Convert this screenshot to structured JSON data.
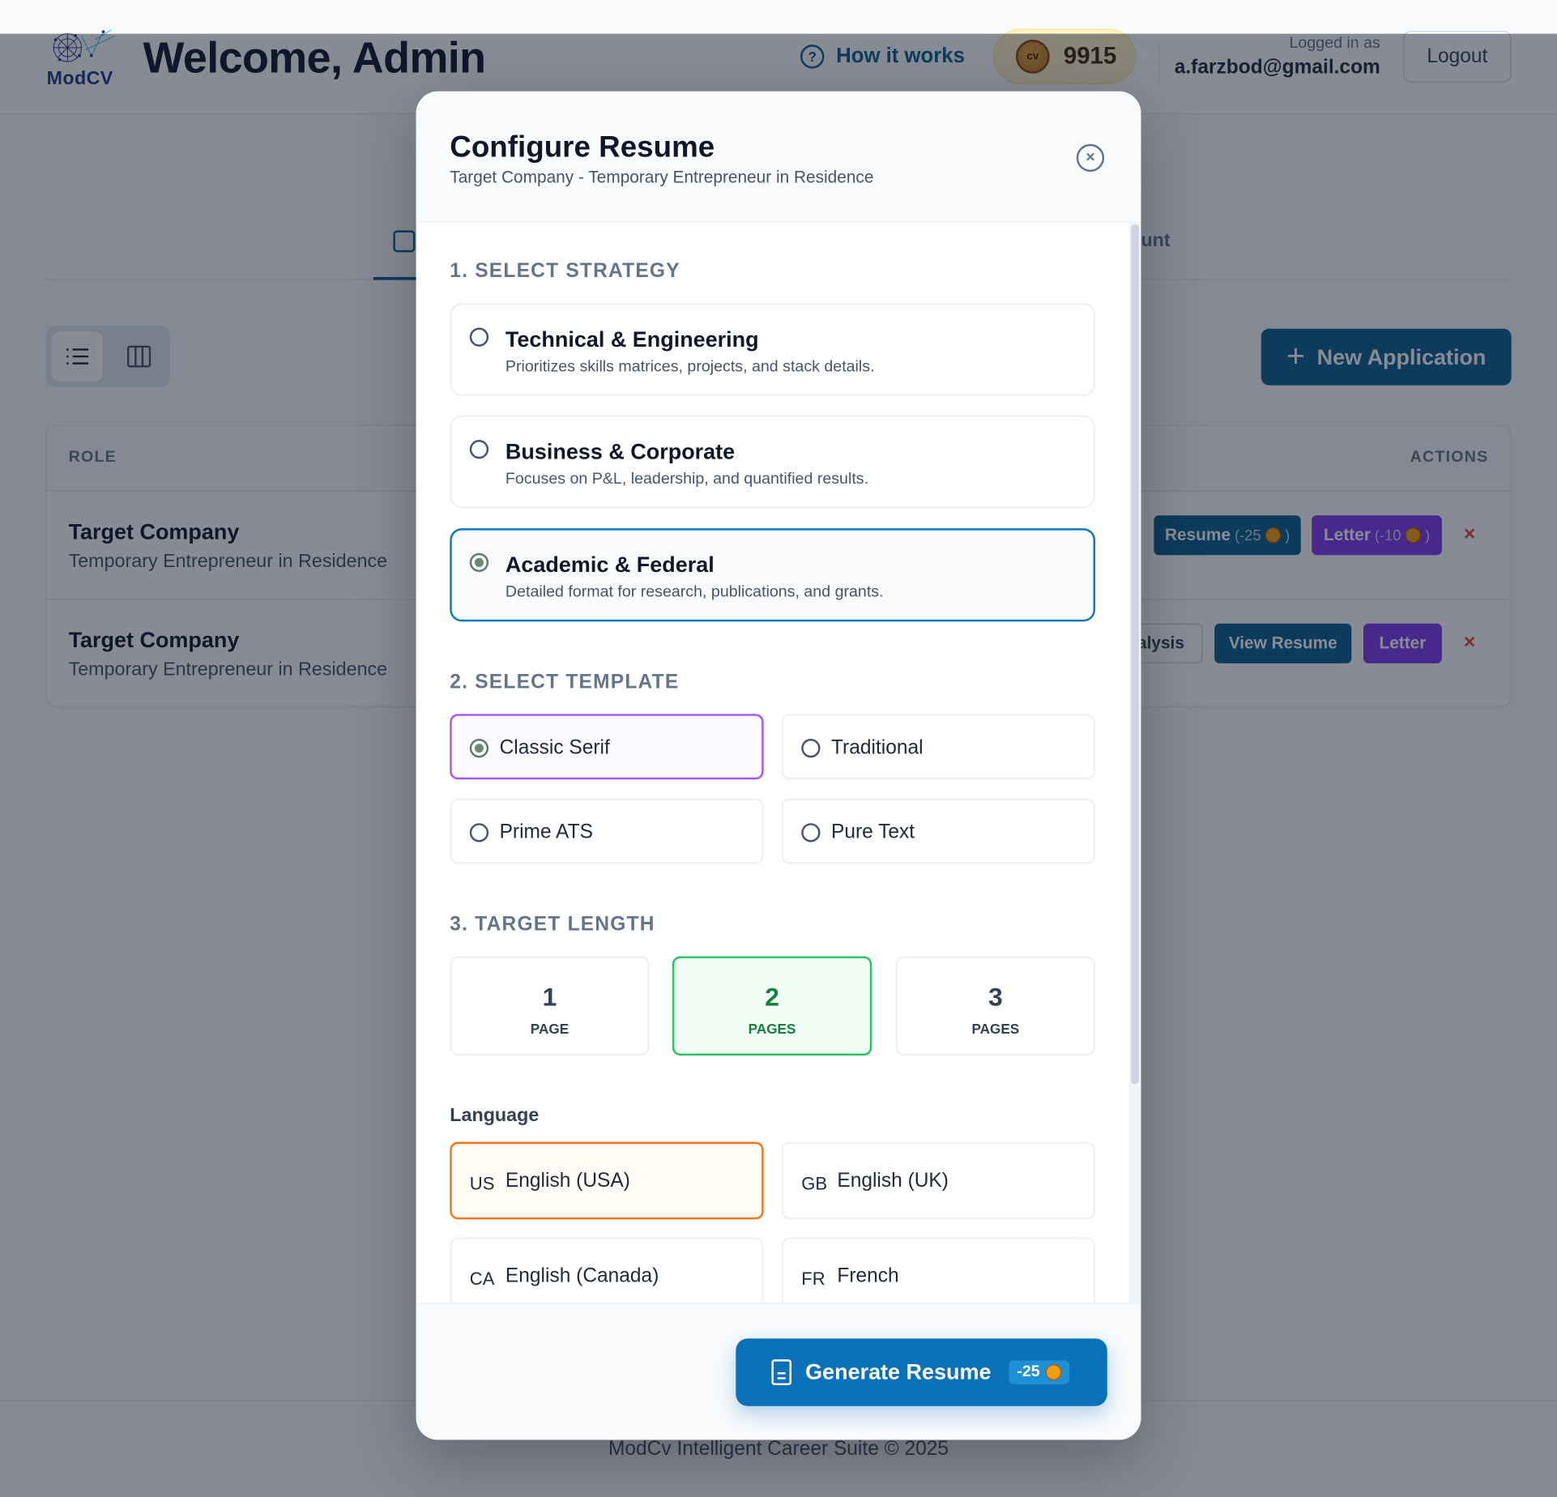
{
  "header": {
    "logo_text": "ModCV",
    "welcome": "Welcome, Admin",
    "how_it_works": "How it works",
    "credits": "9915",
    "coin_label": "cv",
    "logged_in_label": "Logged in as",
    "email": "a.farzbod@gmail.com",
    "logout": "Logout"
  },
  "tabs": {
    "partial_account_label": "unt"
  },
  "toolbar": {
    "new_application": "New Application"
  },
  "table": {
    "col_role": "ROLE",
    "col_actions": "ACTIONS",
    "rows": [
      {
        "company": "Target Company",
        "role": "Temporary Entrepreneur in Residence",
        "resume_label": "Resume",
        "resume_cost": "(-25",
        "letter_label": "Letter",
        "letter_cost": "(-10",
        "close_paren": ")"
      },
      {
        "company": "Target Company",
        "role": "Temporary Entrepreneur in Residence",
        "analysis_label": "alysis",
        "view_resume_label": "View Resume",
        "letter_label": "Letter"
      }
    ],
    "delete_glyph": "×"
  },
  "footer": {
    "text": "ModCv Intelligent Career Suite © 2025"
  },
  "modal": {
    "title": "Configure Resume",
    "subtitle": "Target Company - Temporary Entrepreneur in Residence",
    "close_glyph": "×",
    "section_strategy": "1. SELECT STRATEGY",
    "strategies": [
      {
        "title": "Technical & Engineering",
        "desc": "Prioritizes skills matrices, projects, and stack details.",
        "selected": false
      },
      {
        "title": "Business & Corporate",
        "desc": "Focuses on P&L, leadership, and quantified results.",
        "selected": false
      },
      {
        "title": "Academic & Federal",
        "desc": "Detailed format for research, publications, and grants.",
        "selected": true
      }
    ],
    "section_template": "2. SELECT TEMPLATE",
    "templates": [
      {
        "label": "Classic Serif",
        "selected": true
      },
      {
        "label": "Traditional",
        "selected": false
      },
      {
        "label": "Prime ATS",
        "selected": false
      },
      {
        "label": "Pure Text",
        "selected": false
      }
    ],
    "section_length": "3. TARGET LENGTH",
    "lengths": [
      {
        "num": "1",
        "unit": "PAGE",
        "selected": false
      },
      {
        "num": "2",
        "unit": "PAGES",
        "selected": true
      },
      {
        "num": "3",
        "unit": "PAGES",
        "selected": false
      }
    ],
    "language_label": "Language",
    "languages": [
      {
        "code": "US",
        "name": "English (USA)",
        "selected": true
      },
      {
        "code": "GB",
        "name": "English (UK)",
        "selected": false
      },
      {
        "code": "CA",
        "name": "English (Canada)",
        "selected": false
      },
      {
        "code": "FR",
        "name": "French",
        "selected": false
      }
    ],
    "generate_label": "Generate Resume",
    "generate_cost": "-25"
  },
  "colors": {
    "primary": "#0b5f8c",
    "letter_purple": "#7c3aed",
    "strategy_selected": "#0b79c2",
    "template_selected": "#a855f7",
    "length_selected": "#22c55e",
    "language_selected": "#f97316",
    "delete_red": "#ef4444"
  }
}
